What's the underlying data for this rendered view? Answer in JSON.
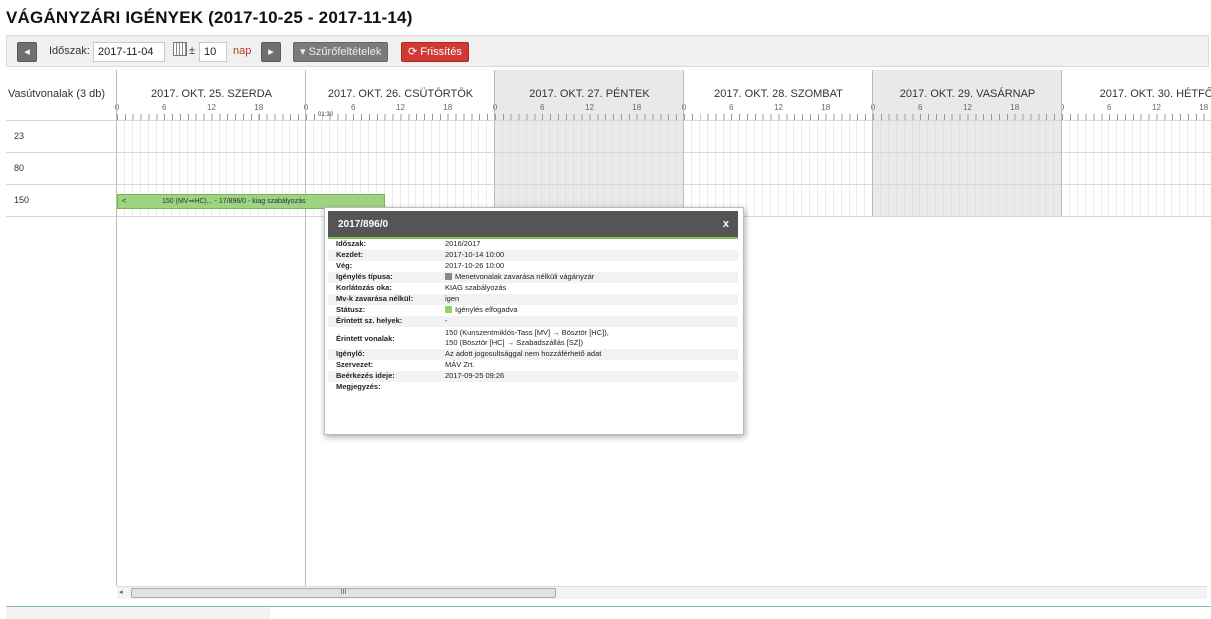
{
  "page": {
    "title": "VÁGÁNYZÁRI IGÉNYEK (2017-10-25 - 2017-11-14)"
  },
  "toolbar": {
    "prev_icon": "chevron-left-icon",
    "period_label": "Időszak:",
    "date_value": "2017-11-04",
    "plusminus": "±",
    "days_value": "10",
    "days_unit": "nap",
    "next_icon": "chevron-right-icon",
    "filter_label": "▾ Szűrőfeltételek",
    "refresh_label": "⟳ Frissítés"
  },
  "timeline": {
    "lines_header": "Vasútvonalak (3 db)",
    "days": [
      {
        "label": "2017. OKT. 25. SZERDA",
        "shaded": false
      },
      {
        "label": "2017. OKT. 26. CSÜTÖRTÖK",
        "shaded": false
      },
      {
        "label": "2017. OKT. 27. PÉNTEK",
        "shaded": true
      },
      {
        "label": "2017. OKT. 28. SZOMBAT",
        "shaded": false
      },
      {
        "label": "2017. OKT. 29. VASÁRNAP",
        "shaded": true
      },
      {
        "label": "2017. OKT. 30. HÉTFŐ",
        "shaded": false
      }
    ],
    "hour_labels": [
      "0",
      "6",
      "12",
      "18"
    ],
    "time_marker": "01:30",
    "rows": [
      "23",
      "80",
      "150"
    ],
    "bar": {
      "arrow": "<",
      "text": "150 (MV⇒HC)... - 17/896/0 - kiag szabályozás",
      "color": "#9ed480"
    }
  },
  "popup": {
    "title": "2017/896/0",
    "close": "x",
    "fields": [
      {
        "key": "Időszak:",
        "value": "2016/2017"
      },
      {
        "key": "Kezdet:",
        "value": "2017-10-14 10:00"
      },
      {
        "key": "Vég:",
        "value": "2017-10-26 10:00"
      },
      {
        "key": "Igénylés típusa:",
        "value": "Menetvonalak zavarása nélküli vágányzár",
        "swatch": "#888888"
      },
      {
        "key": "Korlátozás oka:",
        "value": "KIAG szabályozás"
      },
      {
        "key": "Mv-k zavarása nélkül:",
        "value": "igen"
      },
      {
        "key": "Státusz:",
        "value": "Igénylés elfogadva",
        "swatch": "#8fd36b"
      },
      {
        "key": "Érintett sz. helyek:",
        "value": "-"
      },
      {
        "key": "Érintett vonalak:",
        "value": "150 (Kunszentmiklós-Tass [MV] → Bösztör [HC]),",
        "value2": "150 (Bösztör [HC] → Szabadszállás [SZ])"
      },
      {
        "key": "Igénylő:",
        "value": "Az adott jogosultsággal nem hozzáférhető adat"
      },
      {
        "key": "Szervezet:",
        "value": "MÁV Zrt."
      },
      {
        "key": "Beérkezés ideje:",
        "value": "2017-09-25 09:26"
      },
      {
        "key": "Megjegyzés:",
        "value": ""
      }
    ]
  },
  "scrollbar": {
    "left_arrow": "◂",
    "thumb_grip": "III"
  }
}
